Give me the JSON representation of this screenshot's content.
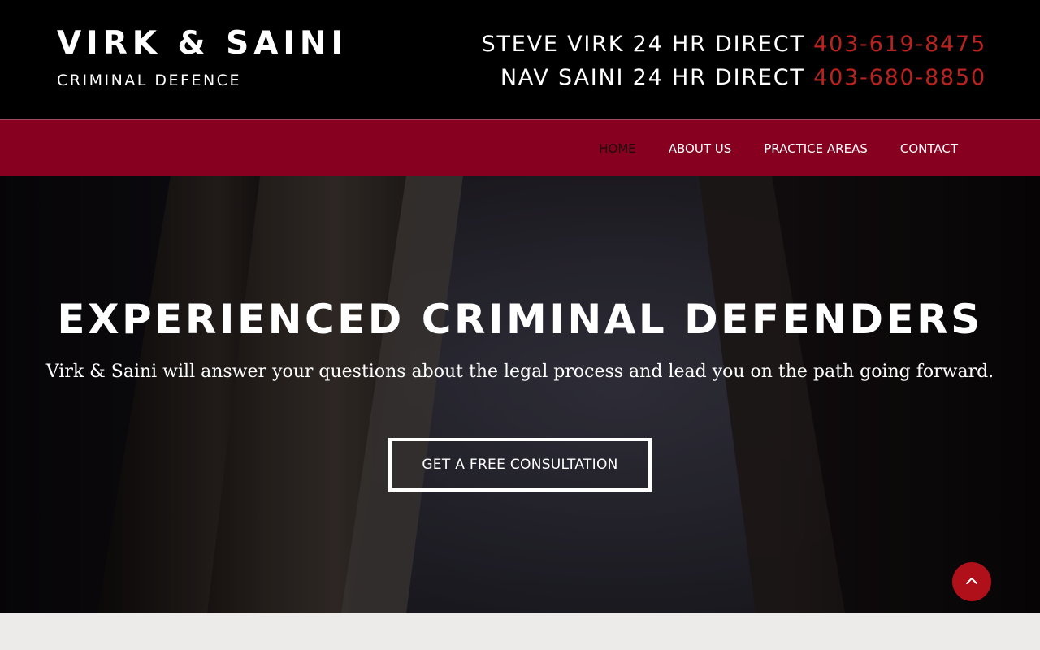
{
  "brand": {
    "name": "VIRK & SAINI",
    "tagline": "CRIMINAL DEFENCE"
  },
  "contacts": [
    {
      "label": "STEVE VIRK 24 HR DIRECT",
      "phone": "403-619-8475"
    },
    {
      "label": "NAV SAINI 24 HR DIRECT",
      "phone": "403-680-8850"
    }
  ],
  "nav": {
    "items": [
      {
        "label": "HOME",
        "active": true
      },
      {
        "label": "ABOUT US",
        "active": false
      },
      {
        "label": "PRACTICE AREAS",
        "active": false
      },
      {
        "label": "CONTACT",
        "active": false
      }
    ]
  },
  "hero": {
    "title": "EXPERIENCED CRIMINAL DEFENDERS",
    "subtitle": "Virk & Saini will answer your questions about the legal process and lead you on the path going forward.",
    "cta_label": "GET A FREE CONSULTATION"
  },
  "scroll_top": {
    "icon": "chevron-up-icon"
  },
  "colors": {
    "accent_red": "#870020",
    "phone_red": "#b8231f",
    "button_red": "#b0101a",
    "header_bg": "#000000"
  }
}
